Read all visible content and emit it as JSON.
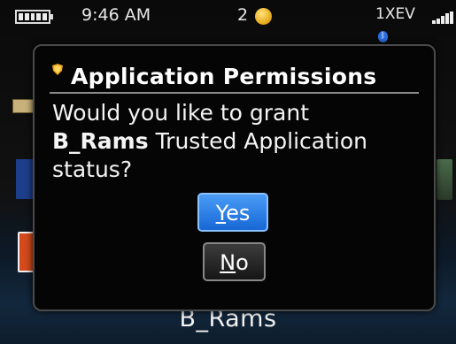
{
  "status_bar": {
    "time": "9:46 AM",
    "notification_count": "2",
    "network": "1XEV",
    "battery_icon": "battery-icon",
    "signal_icon": "signal-bars-icon",
    "bluetooth_icon": "bluetooth-icon"
  },
  "background": {
    "selected_app_label": "B_Rams"
  },
  "dialog": {
    "title": "Application Permissions",
    "message_prefix": "Would you like to grant",
    "app_name": "B_Rams",
    "message_suffix": "Trusted Application status?",
    "yes_first": "Y",
    "yes_rest": "es",
    "no_first": "N",
    "no_rest": "o"
  },
  "colors": {
    "yes_button": "#1f73e0",
    "dialog_bg": "#050505"
  }
}
